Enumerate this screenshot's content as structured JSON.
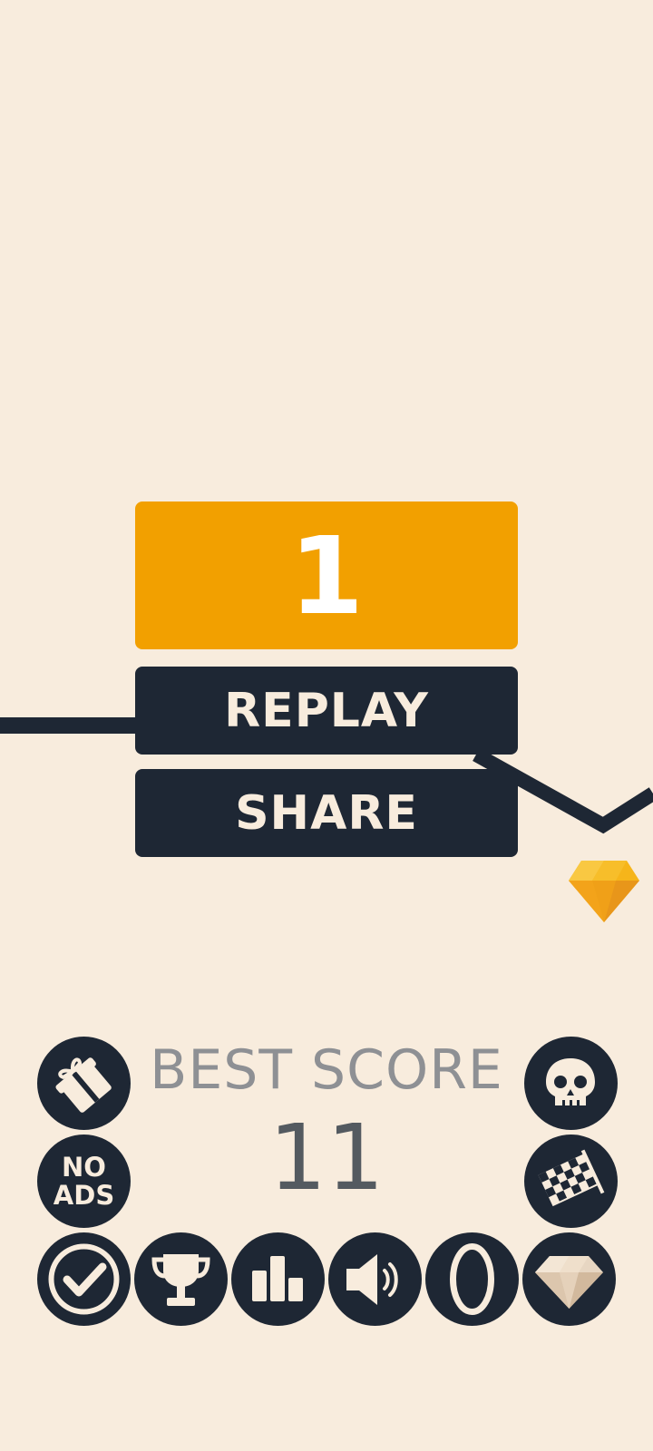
{
  "game": {
    "current_score": "1",
    "replay_label": "REPLAY",
    "share_label": "SHARE",
    "best_score_label": "BEST SCORE",
    "best_score_value": "11"
  },
  "menu": {
    "no_ads_line1": "NO",
    "no_ads_line2": "ADS"
  },
  "icons": {
    "left_column": [
      "gift-icon",
      "no-ads-icon"
    ],
    "right_column": [
      "skull-icon",
      "checkered-flag-icon"
    ],
    "bottom_row": [
      "checkmark-icon",
      "trophy-icon",
      "leaderboard-icon",
      "sound-icon",
      "ring-icon",
      "diamond-icon"
    ]
  },
  "colors": {
    "background": "#f8ecdd",
    "score_panel": "#f2a000",
    "dark": "#1e2734",
    "best_label": "#8e9094",
    "best_value": "#545a60",
    "gem": "#f6b51a"
  }
}
